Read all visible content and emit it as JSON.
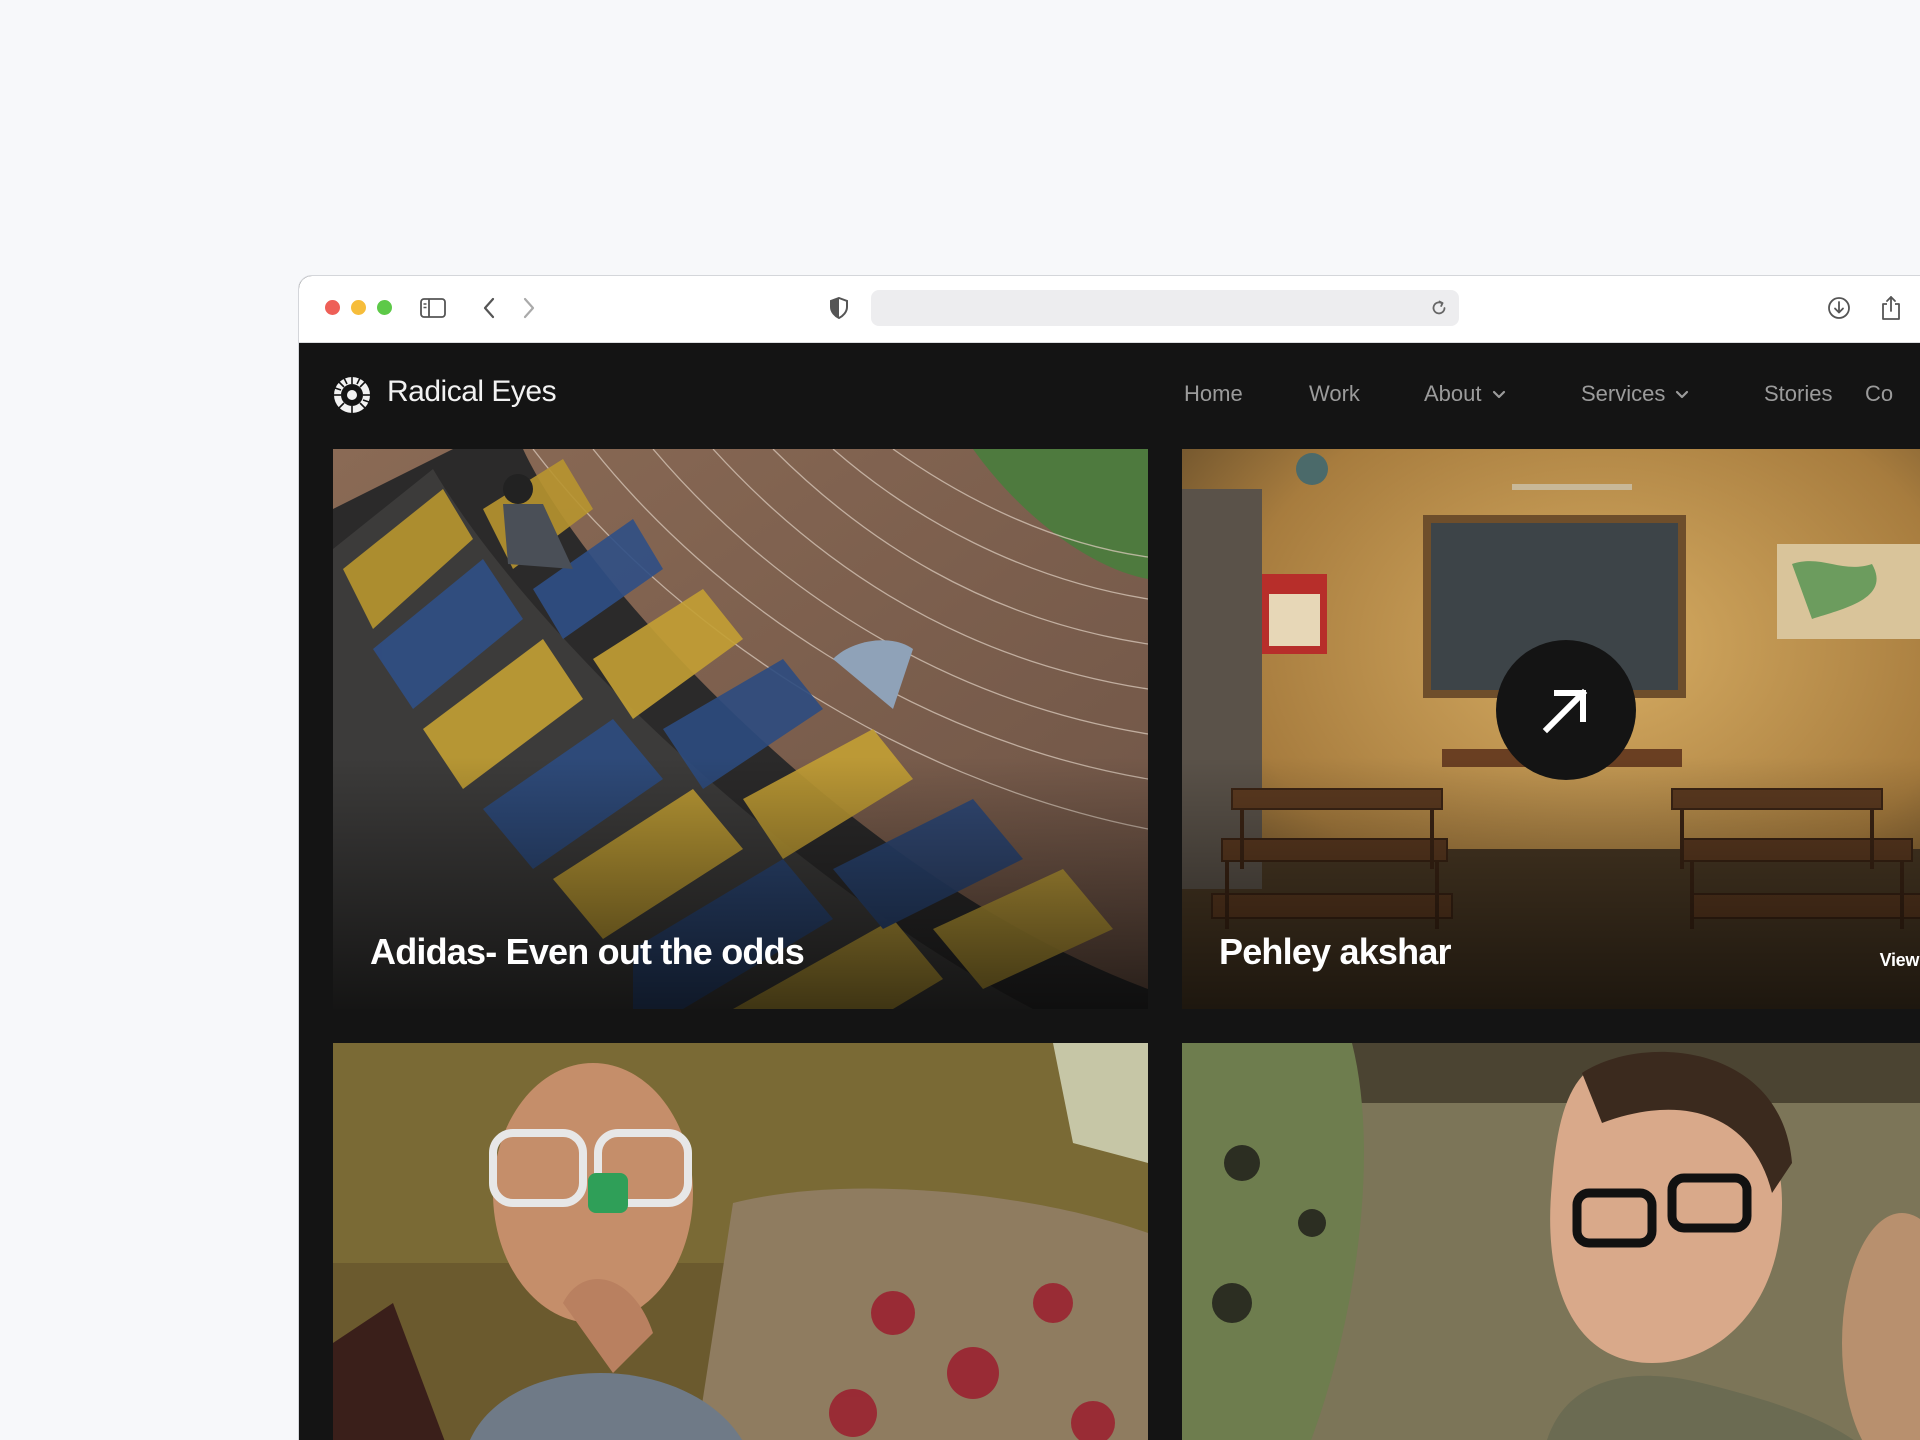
{
  "browser": {
    "url": "",
    "icons": [
      "sidebar-icon",
      "back-icon",
      "forward-icon",
      "shield-icon",
      "reload-icon",
      "download-icon",
      "share-icon"
    ]
  },
  "site": {
    "brand": "Radical Eyes",
    "nav": [
      {
        "label": "Home"
      },
      {
        "label": "Work"
      },
      {
        "label": "About",
        "has_dropdown": true
      },
      {
        "label": "Services",
        "has_dropdown": true
      },
      {
        "label": "Stories"
      },
      {
        "label": "Co"
      }
    ]
  },
  "cards": [
    {
      "title": "Adidas- Even out the odds"
    },
    {
      "title": "Pehley akshar",
      "cta": "View Case S"
    },
    {
      "title": ""
    },
    {
      "title": ""
    }
  ],
  "colors": {
    "page_bg": "#f7f8fa",
    "site_bg": "#141414",
    "nav_text": "#9b9b9b",
    "brand_text": "#f2f2f2"
  }
}
